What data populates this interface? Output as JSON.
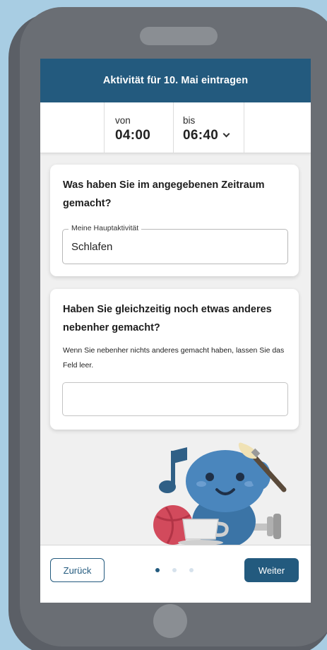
{
  "header": {
    "title": "Aktivität für 10. Mai eintragen"
  },
  "time": {
    "from_label": "von",
    "from_value": "04:00",
    "to_label": "bis",
    "to_value": "06:40"
  },
  "card1": {
    "question": "Was haben Sie im angegebenen Zeitraum gemacht?",
    "field_legend": "Meine Hauptaktivität",
    "field_value": "Schlafen"
  },
  "card2": {
    "question": "Haben Sie gleichzeitig noch etwas anderes nebenher gemacht?",
    "hint": "Wenn Sie nebenher nichts anderes gemacht haben, lassen Sie das Feld leer.",
    "field_value": ""
  },
  "nav": {
    "back_label": "Zurück",
    "next_label": "Weiter",
    "page_indicator": {
      "current": 1,
      "total": 3
    }
  },
  "colors": {
    "primary": "#235a7e",
    "background": "#a8cde3",
    "phone": "#6a6e74"
  }
}
